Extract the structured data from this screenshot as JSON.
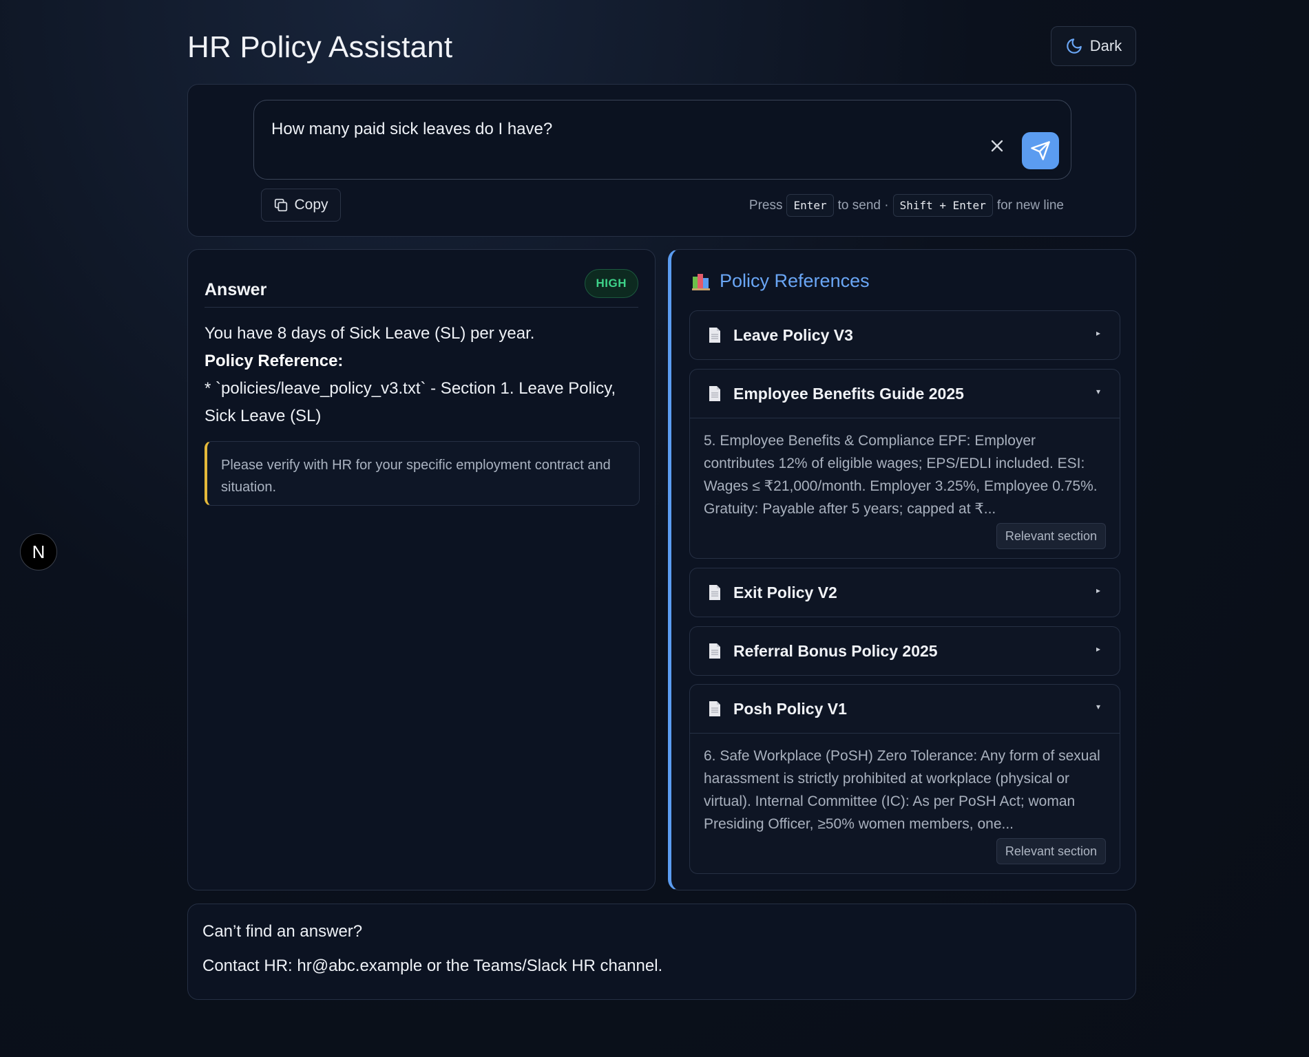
{
  "header": {
    "title": "HR Policy Assistant",
    "theme_label": "Dark"
  },
  "query": {
    "text": "How many paid sick leaves do I have?",
    "copy_label": "Copy",
    "hint": {
      "press": "Press",
      "enter": "Enter",
      "to_send": "to send ·",
      "shift_enter": "Shift + Enter",
      "for_new_line": "for new line"
    }
  },
  "answer": {
    "title": "Answer",
    "confidence": "HIGH",
    "line1": "You have 8 days of Sick Leave (SL) per year.",
    "policy_ref_label": "Policy Reference:",
    "policy_ref_text": "* `policies/leave_policy_v3.txt` - Section 1. Leave Policy, Sick Leave (SL)",
    "note": "Please verify with HR for your specific employment contract and situation."
  },
  "references": {
    "title": "Policy References",
    "items": [
      {
        "name": "Leave Policy V3",
        "expanded": false,
        "arrow": "▸"
      },
      {
        "name": "Employee Benefits Guide 2025",
        "expanded": true,
        "arrow": "▾",
        "snippet": "5. Employee Benefits & Compliance EPF: Employer contributes 12% of eligible wages; EPS/EDLI included. ESI: Wages ≤ ₹21,000/month. Employer 3.25%, Employee 0.75%. Gratuity: Payable after 5 years; capped at ₹...",
        "tag": "Relevant section"
      },
      {
        "name": "Exit Policy V2",
        "expanded": false,
        "arrow": "▸"
      },
      {
        "name": "Referral Bonus Policy 2025",
        "expanded": false,
        "arrow": "▸"
      },
      {
        "name": "Posh Policy V1",
        "expanded": true,
        "arrow": "▾",
        "snippet": "6. Safe Workplace (PoSH) Zero Tolerance: Any form of sexual harassment is strictly prohibited at workplace (physical or virtual). Internal Committee (IC): As per PoSH Act; woman Presiding Officer, ≥50% women members, one...",
        "tag": "Relevant section"
      }
    ]
  },
  "contact": {
    "question": "Can’t find an answer?",
    "line": "Contact HR: hr@abc.example or the Teams/Slack HR channel."
  },
  "floating": {
    "label": "N"
  },
  "colors": {
    "accent": "#5b9cf0",
    "badge_green": "#3ed48a",
    "note_border": "#e5b93a"
  }
}
